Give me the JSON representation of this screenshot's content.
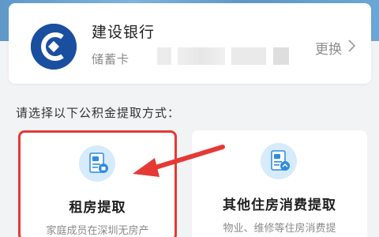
{
  "bank": {
    "name": "建设银行",
    "card_type": "储蓄卡",
    "change_label": "更换",
    "logo_icon": "ccb-logo-icon",
    "logo_color": "#1a4fa0"
  },
  "prompt": "请选择以下公积金提取方式：",
  "options": [
    {
      "title": "租房提取",
      "description": "家庭成员在深圳无房产",
      "icon": "rental-document-icon",
      "highlighted": true
    },
    {
      "title": "其他住房消费提取",
      "description": "物业、维修等住房消费提",
      "icon": "housing-consumption-document-icon",
      "highlighted": false
    }
  ],
  "colors": {
    "accent_blue": "#2f8be0",
    "highlight_red": "#e53935",
    "icon_background": "#d6ebfb"
  }
}
